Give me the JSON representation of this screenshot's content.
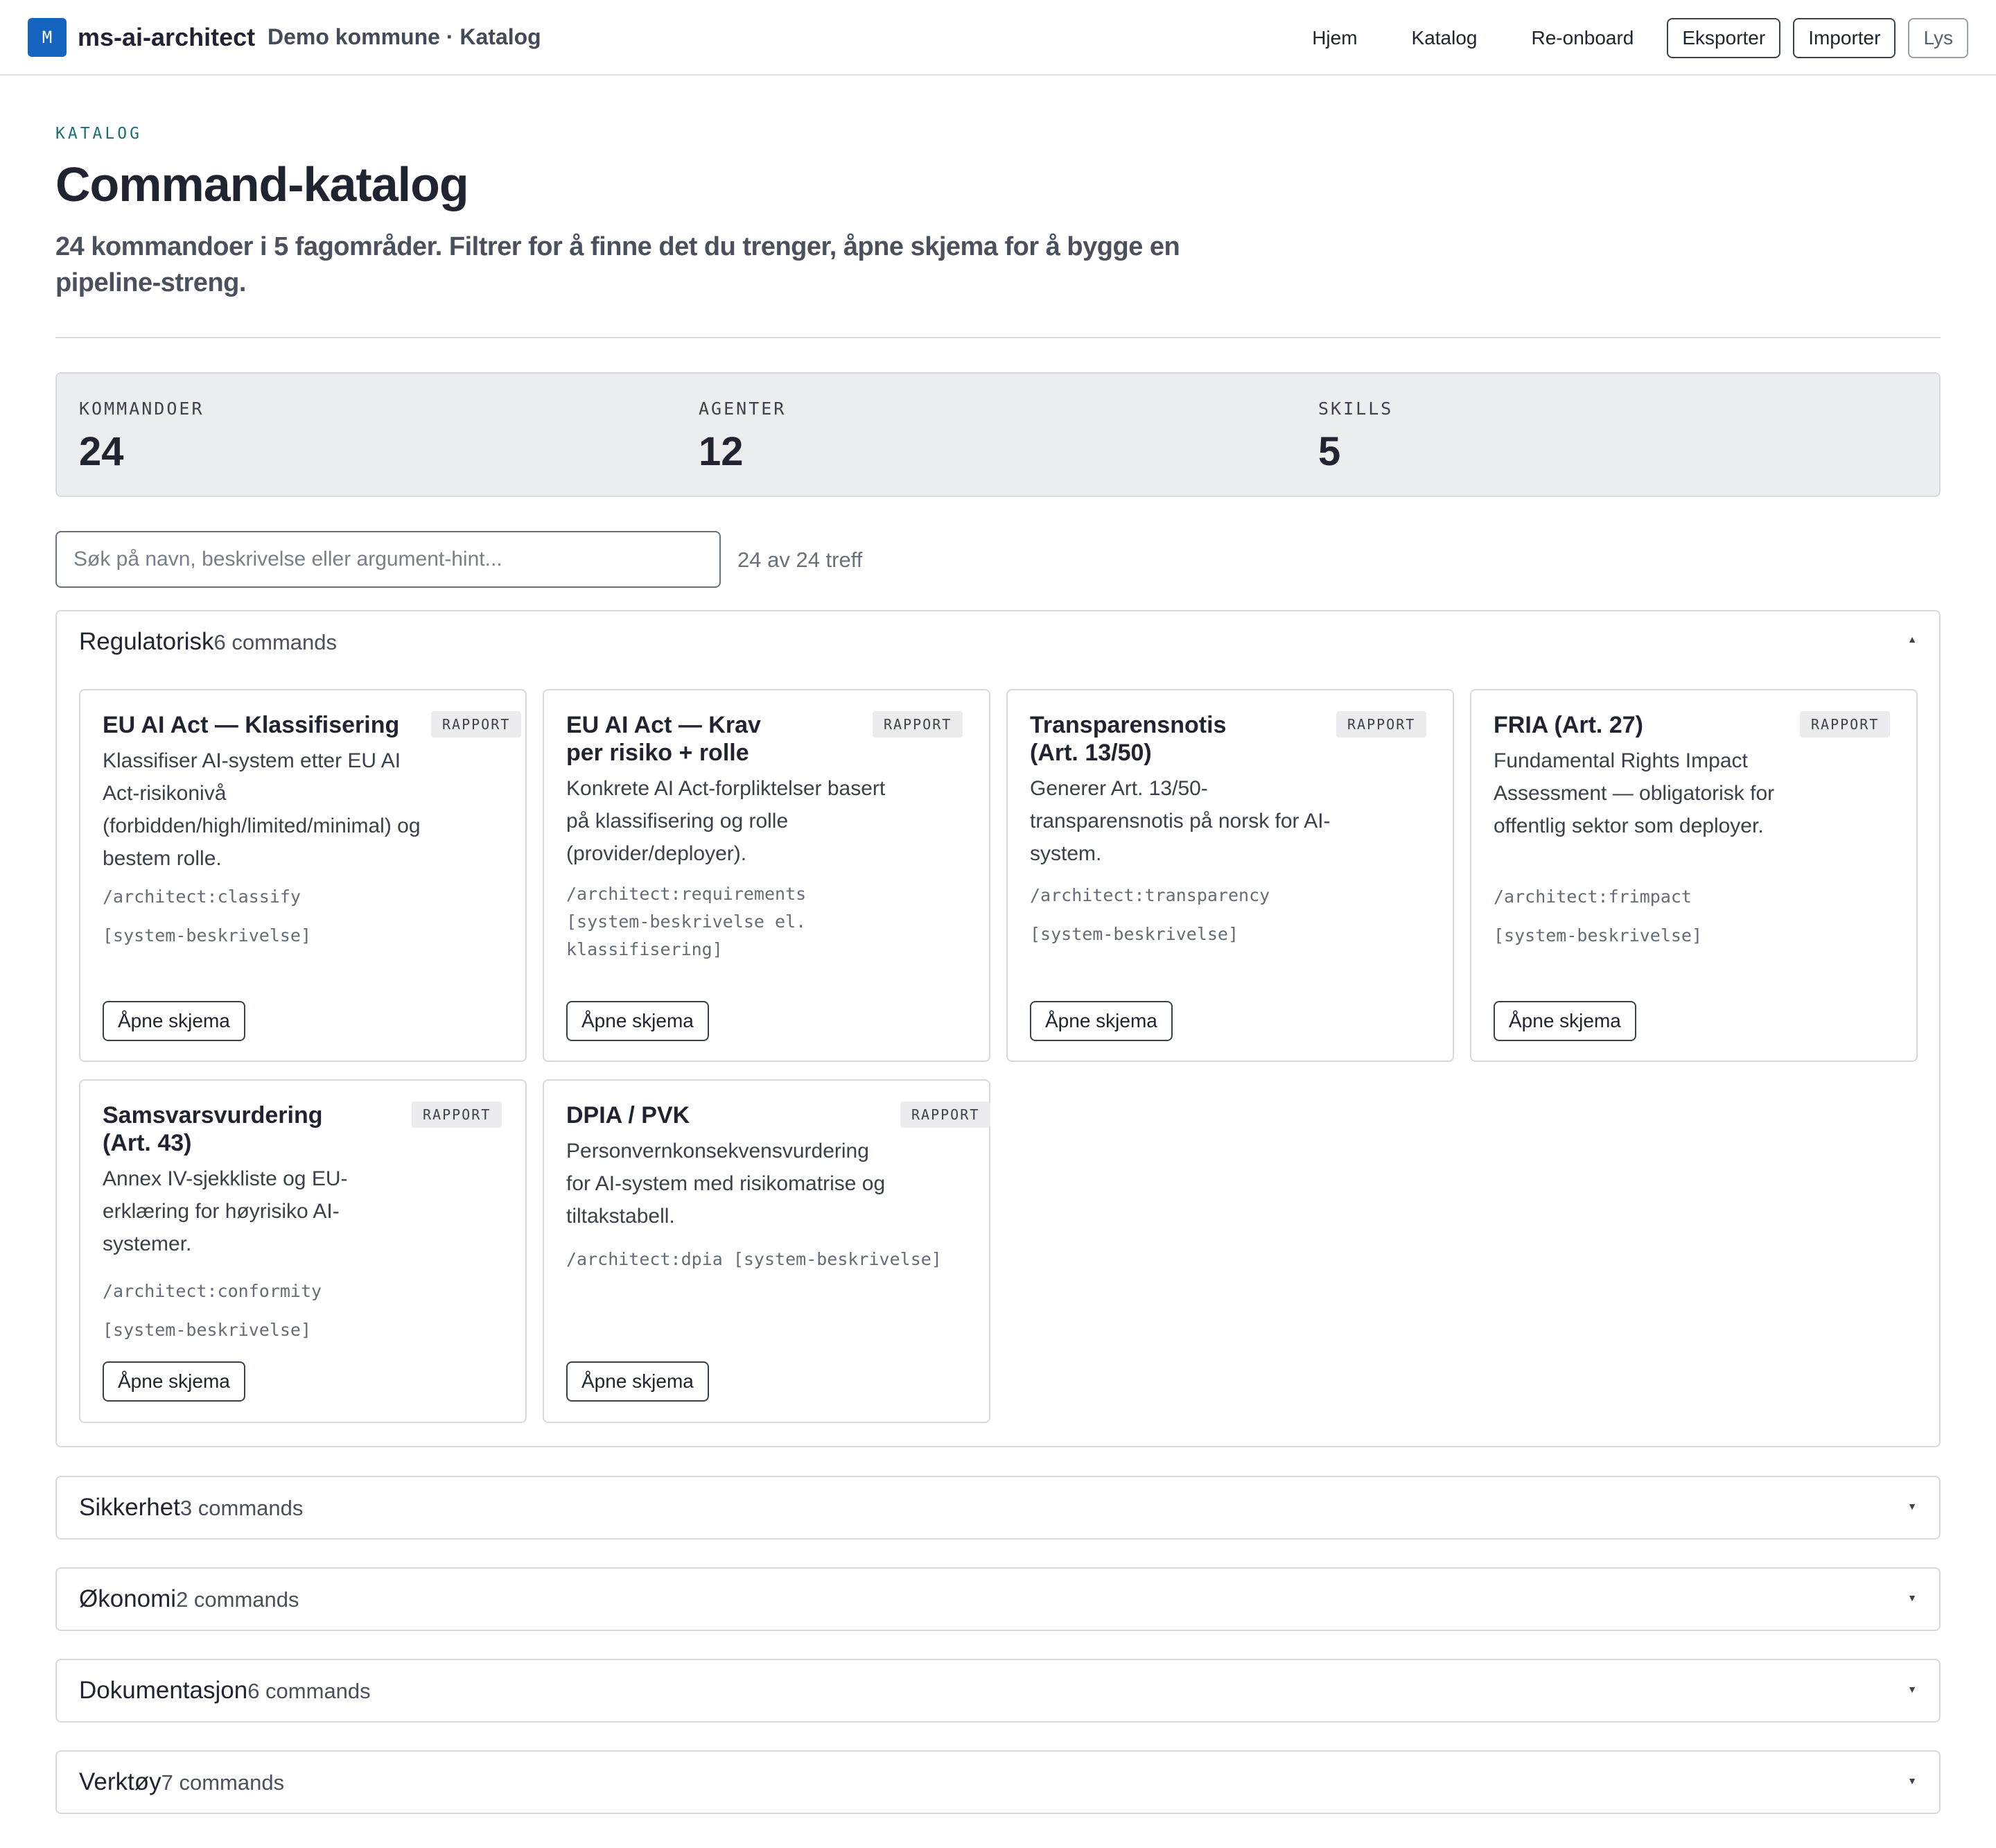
{
  "app": {
    "logo_letter": "M",
    "name": "ms-ai-architect",
    "context": "Demo kommune · Katalog"
  },
  "nav": {
    "links": [
      "Hjem",
      "Katalog",
      "Re-onboard"
    ],
    "buttons": [
      "Eksporter",
      "Importer",
      "Lys"
    ]
  },
  "header": {
    "eyebrow": "KATALOG",
    "title": "Command-katalog",
    "subtitle": "24 kommandoer i 5 fagområder. Filtrer for å finne det du trenger, åpne skjema for å bygge en pipeline-streng."
  },
  "stats": [
    {
      "label": "KOMMANDOER",
      "value": "24"
    },
    {
      "label": "AGENTER",
      "value": "12"
    },
    {
      "label": "SKILLS",
      "value": "5"
    }
  ],
  "search": {
    "placeholder": "Søk på navn, beskrivelse eller argument-hint...",
    "value": "",
    "hit_count": "24 av 24 treff"
  },
  "icons": {
    "expanded": "chevron-up-icon",
    "collapsed": "chevron-down-icon"
  },
  "categories": [
    {
      "name": "Regulatorisk",
      "count": "6 commands",
      "expanded": true,
      "cards": [
        {
          "title": "EU AI Act — Klassifisering",
          "badge": "RAPPORT",
          "description": "Klassifiser AI-system etter EU AI Act-risikonivå (forbidden/high/limited/minimal) og bestem rolle.",
          "command": "/architect:classify [system-beskrivelse]",
          "button": "Åpne skjema"
        },
        {
          "title": "EU AI Act — Krav per risiko + rolle",
          "badge": "RAPPORT",
          "description": "Konkrete AI Act-forpliktelser basert på klassifisering og rolle (provider/deployer).",
          "command": "/architect:requirements [system-beskrivelse el. klassifisering]",
          "button": "Åpne skjema"
        },
        {
          "title": "Transparensnotis (Art. 13/50)",
          "badge": "RAPPORT",
          "description": "Generer Art. 13/50-transparensnotis på norsk for AI-system.",
          "command": "/architect:transparency [system-beskrivelse]",
          "button": "Åpne skjema"
        },
        {
          "title": "FRIA (Art. 27)",
          "badge": "RAPPORT",
          "description": "Fundamental Rights Impact Assessment — obligatorisk for offentlig sektor som deployer.",
          "command": "/architect:frimpact [system-beskrivelse]",
          "button": "Åpne skjema"
        },
        {
          "title": "Samsvarsvurdering (Art. 43)",
          "badge": "RAPPORT",
          "description": "Annex IV-sjekkliste og EU-erklæring for høyrisiko AI-systemer.",
          "command": "/architect:conformity [system-beskrivelse]",
          "button": "Åpne skjema"
        },
        {
          "title": "DPIA / PVK",
          "badge": "RAPPORT",
          "description": "Personvernkonsekvensvurdering for AI-system med risikomatrise og tiltakstabell.",
          "command": "/architect:dpia [system-beskrivelse]",
          "button": "Åpne skjema"
        }
      ]
    },
    {
      "name": "Sikkerhet",
      "count": "3 commands",
      "expanded": false
    },
    {
      "name": "Økonomi",
      "count": "2 commands",
      "expanded": false
    },
    {
      "name": "Dokumentasjon",
      "count": "6 commands",
      "expanded": false
    },
    {
      "name": "Verktøy",
      "count": "7 commands",
      "expanded": false
    }
  ]
}
